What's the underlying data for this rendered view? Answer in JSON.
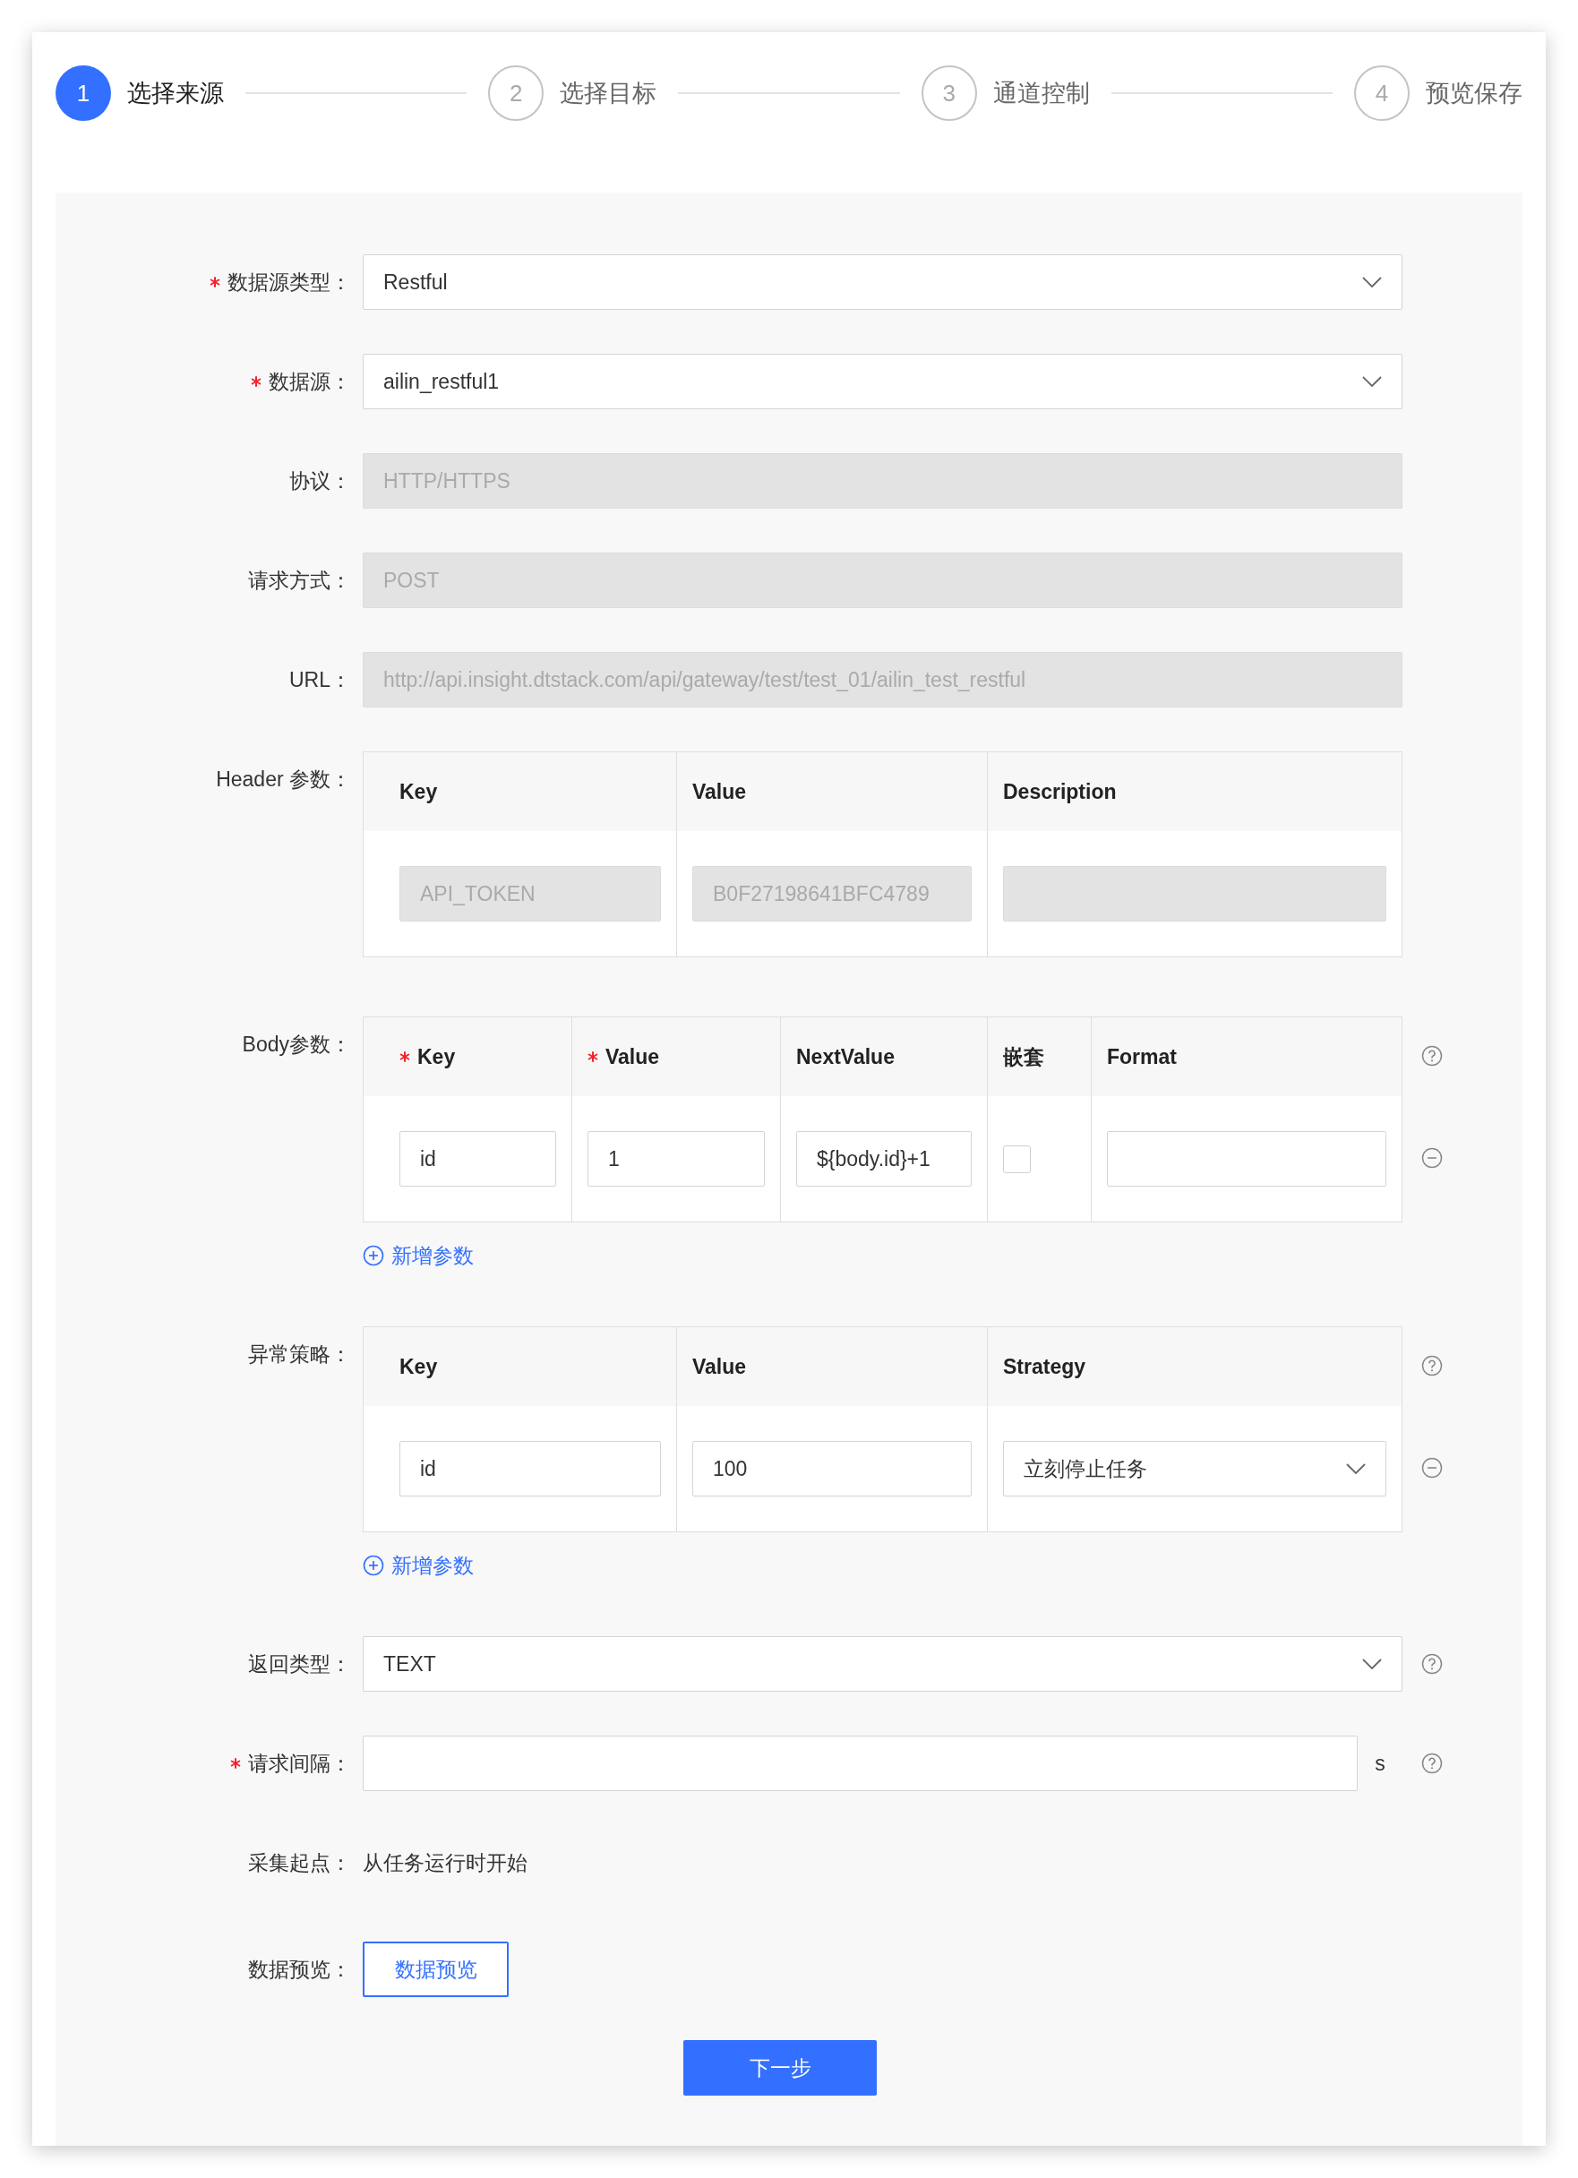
{
  "steps": [
    {
      "number": "1",
      "label": "选择来源",
      "selected": true
    },
    {
      "number": "2",
      "label": "选择目标",
      "selected": false
    },
    {
      "number": "3",
      "label": "通道控制",
      "selected": false
    },
    {
      "number": "4",
      "label": "预览保存",
      "selected": false
    }
  ],
  "fields": [
    {
      "kind": "select",
      "label": "数据源类型：",
      "required": true,
      "value": "Restful"
    },
    {
      "kind": "select",
      "label": "数据源：",
      "required": true,
      "value": "ailin_restful1"
    },
    {
      "kind": "input",
      "label": "协议：",
      "disabled": true,
      "value": "HTTP/HTTPS"
    },
    {
      "kind": "input",
      "label": "请求方式：",
      "disabled": true,
      "value": "POST"
    },
    {
      "kind": "input",
      "label": "URL：",
      "disabled": true,
      "value": "http://api.insight.dtstack.com/api/gateway/test/test_01/ailin_test_restful"
    },
    {
      "kind": "table",
      "label": "Header 参数：",
      "columns": [
        {
          "title": "Key",
          "required": false
        },
        {
          "title": "Value",
          "required": false
        },
        {
          "title": "Description",
          "required": false
        }
      ],
      "rows": [
        {
          "removable": false,
          "cells": [
            {
              "kind": "input",
              "disabled": true,
              "value": "API_TOKEN"
            },
            {
              "kind": "input",
              "disabled": true,
              "value": "B0F27198641BFC4789"
            },
            {
              "kind": "input",
              "disabled": true
            }
          ]
        }
      ]
    },
    {
      "kind": "table",
      "label": "Body参数：",
      "help": true,
      "add_link": "新增参数",
      "columns": [
        {
          "title": "Key",
          "required": true
        },
        {
          "title": "Value",
          "required": true
        },
        {
          "title": "NextValue",
          "required": false
        },
        {
          "title": "嵌套",
          "required": false
        },
        {
          "title": "Format",
          "required": false
        }
      ],
      "rows": [
        {
          "removable": true,
          "cells": [
            {
              "kind": "input",
              "disabled": false,
              "value": "id"
            },
            {
              "kind": "input",
              "disabled": false,
              "value": "1"
            },
            {
              "kind": "input",
              "disabled": false,
              "value": "${body.id}+1"
            },
            {
              "kind": "checkbox",
              "checked": false
            },
            {
              "kind": "input",
              "disabled": false
            }
          ]
        }
      ]
    },
    {
      "kind": "table",
      "label": "异常策略：",
      "help": true,
      "add_link": "新增参数",
      "columns": [
        {
          "title": "Key",
          "required": false
        },
        {
          "title": "Value",
          "required": false
        },
        {
          "title": "Strategy",
          "required": false
        }
      ],
      "rows": [
        {
          "removable": true,
          "cells": [
            {
              "kind": "input",
              "disabled": false,
              "value": "id"
            },
            {
              "kind": "input",
              "disabled": false,
              "value": "100"
            },
            {
              "kind": "select",
              "value": "立刻停止任务"
            }
          ]
        }
      ]
    },
    {
      "kind": "select",
      "label": "返回类型：",
      "required": false,
      "help": true,
      "value": "TEXT"
    },
    {
      "kind": "input",
      "label": "请求间隔：",
      "required": true,
      "disabled": false,
      "suffix": "s",
      "help": true
    },
    {
      "kind": "text",
      "label": "采集起点：",
      "value": "从任务运行时开始"
    },
    {
      "kind": "button",
      "label": "数据预览：",
      "value": "数据预览"
    }
  ],
  "next_button": "下一步"
}
